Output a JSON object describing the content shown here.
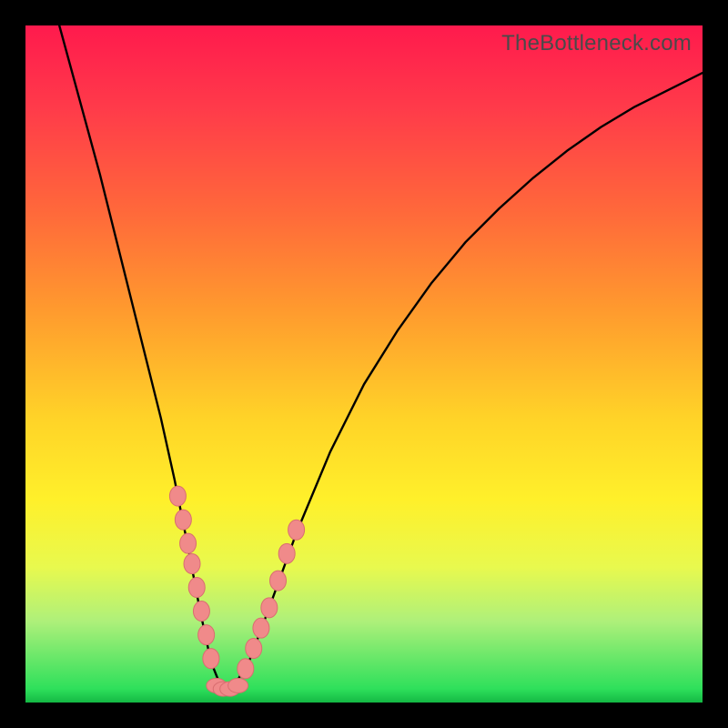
{
  "watermark": {
    "text": "TheBottleneck.com"
  },
  "colors": {
    "black": "#000000",
    "marker_fill": "#f08a8a",
    "marker_stroke": "#d96e70",
    "curve": "#000000"
  },
  "chart_data": {
    "type": "line",
    "title": "",
    "xlabel": "",
    "ylabel": "",
    "xlim": [
      0,
      100
    ],
    "ylim": [
      0,
      100
    ],
    "grid": false,
    "legend": false,
    "series": [
      {
        "name": "curve",
        "x": [
          5,
          8,
          11,
          14,
          17,
          20,
          22,
          24,
          25.7,
          27.4,
          29,
          30.5,
          33,
          36,
          40,
          45,
          50,
          55,
          60,
          65,
          70,
          75,
          80,
          85,
          90,
          95,
          100
        ],
        "y": [
          100,
          89,
          78,
          66,
          54,
          42,
          33,
          23,
          14,
          6,
          2,
          2,
          6,
          14,
          25,
          37,
          47,
          55,
          62,
          68,
          73,
          77.5,
          81.5,
          85,
          88,
          90.5,
          93
        ]
      }
    ],
    "markers_left": {
      "x": [
        22.5,
        23.3,
        24.0,
        24.6,
        25.3,
        26.0,
        26.7,
        27.4
      ],
      "y": [
        30.5,
        27.0,
        23.5,
        20.5,
        17.0,
        13.5,
        10.0,
        6.5
      ]
    },
    "markers_right": {
      "x": [
        32.5,
        33.7,
        34.8,
        36.0,
        37.3,
        38.6,
        40.0
      ],
      "y": [
        5.0,
        8.0,
        11.0,
        14.0,
        18.0,
        22.0,
        25.5
      ]
    },
    "markers_bottom": {
      "x": [
        28.2,
        29.2,
        30.2,
        31.4
      ],
      "y": [
        2.5,
        2.0,
        2.0,
        2.5
      ]
    }
  }
}
